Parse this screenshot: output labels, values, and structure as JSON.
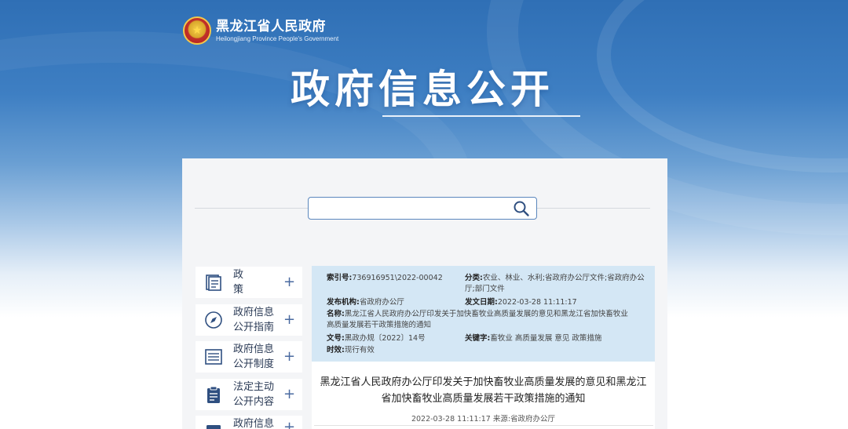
{
  "header": {
    "site_name_cn": "黑龙江省人民政府",
    "site_name_en": "Heilongjiang Province People's Government",
    "page_title": "政府信息公开"
  },
  "search": {
    "placeholder": ""
  },
  "sidebar": {
    "items": [
      {
        "label": "政 策",
        "icon": "policy-book-icon"
      },
      {
        "label": "政府信息公开指南",
        "icon": "compass-icon"
      },
      {
        "label": "政府信息公开制度",
        "icon": "list-document-icon"
      },
      {
        "label": "法定主动公开内容",
        "icon": "clipboard-icon"
      },
      {
        "label": "政府信息",
        "icon": "folder-icon"
      }
    ],
    "expand_symbol": "+"
  },
  "metadata": {
    "index_label": "索引号:",
    "index_value": "736916951\\2022-00042",
    "category_label": "分类:",
    "category_value_line1": "农业、林业、水利;省政府办公厅文件;省政府办公",
    "category_value_line2": "厅;部门文件",
    "issuer_label": "发布机构:",
    "issuer_value": "省政府办公厅",
    "date_label": "发文日期:",
    "date_value": "2022-03-28 11:11:17",
    "name_label": "名称:",
    "name_value_line1": "黑龙江省人民政府办公厅印发关于加快畜牧业高质量发展的意见和黑龙江省加快畜牧业",
    "name_value_line2": "高质量发展若干政策措施的通知",
    "docno_label": "文号:",
    "docno_value": "黑政办规〔2022〕14号",
    "keywords_label": "关键字:",
    "keywords_value": "畜牧业 高质量发展 意见 政策措施",
    "validity_label": "时效:",
    "validity_value": "现行有效"
  },
  "document": {
    "title_line1": "黑龙江省人民政府办公厅印发关于加快畜牧业高质量发展的意见和黑龙江",
    "title_line2": "省加快畜牧业高质量发展若干政策措施的通知",
    "date_source": "2022-03-28 11:11:17 来源:省政府办公厅"
  },
  "colors": {
    "banner_blue": "#2f6fb5",
    "meta_bg": "#d4e7f5",
    "panel_bg": "#f4f5f7",
    "accent": "#4a6aa0"
  }
}
